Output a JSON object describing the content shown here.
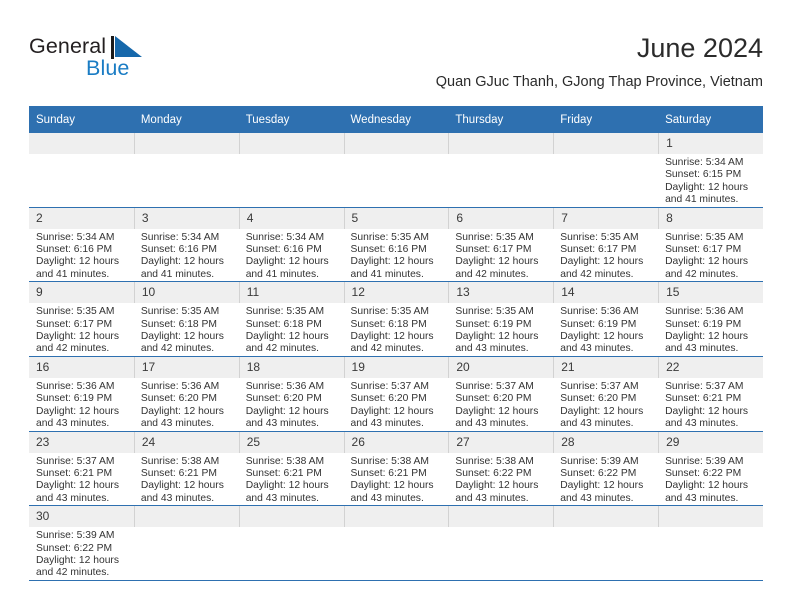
{
  "brand": {
    "name_dark": "General",
    "name_blue": "Blue",
    "flag_icon": "blue-triangle-flag-icon",
    "blue": "#1a7cc4"
  },
  "header": {
    "title": "June 2024",
    "subtitle": "Quan GJuc Thanh, GJong Thap Province, Vietnam"
  },
  "theme": {
    "header_blue": "#2e70b0",
    "daynum_gray": "#efefef",
    "grid_line": "#2e70b0"
  },
  "weekday_headers": [
    "Sunday",
    "Monday",
    "Tuesday",
    "Wednesday",
    "Thursday",
    "Friday",
    "Saturday"
  ],
  "weeks": [
    [
      {
        "empty": true
      },
      {
        "empty": true
      },
      {
        "empty": true
      },
      {
        "empty": true
      },
      {
        "empty": true
      },
      {
        "empty": true
      },
      {
        "day": "1",
        "sunrise": "Sunrise: 5:34 AM",
        "sunset": "Sunset: 6:15 PM",
        "daylight1": "Daylight: 12 hours",
        "daylight2": "and 41 minutes."
      }
    ],
    [
      {
        "day": "2",
        "sunrise": "Sunrise: 5:34 AM",
        "sunset": "Sunset: 6:16 PM",
        "daylight1": "Daylight: 12 hours",
        "daylight2": "and 41 minutes."
      },
      {
        "day": "3",
        "sunrise": "Sunrise: 5:34 AM",
        "sunset": "Sunset: 6:16 PM",
        "daylight1": "Daylight: 12 hours",
        "daylight2": "and 41 minutes."
      },
      {
        "day": "4",
        "sunrise": "Sunrise: 5:34 AM",
        "sunset": "Sunset: 6:16 PM",
        "daylight1": "Daylight: 12 hours",
        "daylight2": "and 41 minutes."
      },
      {
        "day": "5",
        "sunrise": "Sunrise: 5:35 AM",
        "sunset": "Sunset: 6:16 PM",
        "daylight1": "Daylight: 12 hours",
        "daylight2": "and 41 minutes."
      },
      {
        "day": "6",
        "sunrise": "Sunrise: 5:35 AM",
        "sunset": "Sunset: 6:17 PM",
        "daylight1": "Daylight: 12 hours",
        "daylight2": "and 42 minutes."
      },
      {
        "day": "7",
        "sunrise": "Sunrise: 5:35 AM",
        "sunset": "Sunset: 6:17 PM",
        "daylight1": "Daylight: 12 hours",
        "daylight2": "and 42 minutes."
      },
      {
        "day": "8",
        "sunrise": "Sunrise: 5:35 AM",
        "sunset": "Sunset: 6:17 PM",
        "daylight1": "Daylight: 12 hours",
        "daylight2": "and 42 minutes."
      }
    ],
    [
      {
        "day": "9",
        "sunrise": "Sunrise: 5:35 AM",
        "sunset": "Sunset: 6:17 PM",
        "daylight1": "Daylight: 12 hours",
        "daylight2": "and 42 minutes."
      },
      {
        "day": "10",
        "sunrise": "Sunrise: 5:35 AM",
        "sunset": "Sunset: 6:18 PM",
        "daylight1": "Daylight: 12 hours",
        "daylight2": "and 42 minutes."
      },
      {
        "day": "11",
        "sunrise": "Sunrise: 5:35 AM",
        "sunset": "Sunset: 6:18 PM",
        "daylight1": "Daylight: 12 hours",
        "daylight2": "and 42 minutes."
      },
      {
        "day": "12",
        "sunrise": "Sunrise: 5:35 AM",
        "sunset": "Sunset: 6:18 PM",
        "daylight1": "Daylight: 12 hours",
        "daylight2": "and 42 minutes."
      },
      {
        "day": "13",
        "sunrise": "Sunrise: 5:35 AM",
        "sunset": "Sunset: 6:19 PM",
        "daylight1": "Daylight: 12 hours",
        "daylight2": "and 43 minutes."
      },
      {
        "day": "14",
        "sunrise": "Sunrise: 5:36 AM",
        "sunset": "Sunset: 6:19 PM",
        "daylight1": "Daylight: 12 hours",
        "daylight2": "and 43 minutes."
      },
      {
        "day": "15",
        "sunrise": "Sunrise: 5:36 AM",
        "sunset": "Sunset: 6:19 PM",
        "daylight1": "Daylight: 12 hours",
        "daylight2": "and 43 minutes."
      }
    ],
    [
      {
        "day": "16",
        "sunrise": "Sunrise: 5:36 AM",
        "sunset": "Sunset: 6:19 PM",
        "daylight1": "Daylight: 12 hours",
        "daylight2": "and 43 minutes."
      },
      {
        "day": "17",
        "sunrise": "Sunrise: 5:36 AM",
        "sunset": "Sunset: 6:20 PM",
        "daylight1": "Daylight: 12 hours",
        "daylight2": "and 43 minutes."
      },
      {
        "day": "18",
        "sunrise": "Sunrise: 5:36 AM",
        "sunset": "Sunset: 6:20 PM",
        "daylight1": "Daylight: 12 hours",
        "daylight2": "and 43 minutes."
      },
      {
        "day": "19",
        "sunrise": "Sunrise: 5:37 AM",
        "sunset": "Sunset: 6:20 PM",
        "daylight1": "Daylight: 12 hours",
        "daylight2": "and 43 minutes."
      },
      {
        "day": "20",
        "sunrise": "Sunrise: 5:37 AM",
        "sunset": "Sunset: 6:20 PM",
        "daylight1": "Daylight: 12 hours",
        "daylight2": "and 43 minutes."
      },
      {
        "day": "21",
        "sunrise": "Sunrise: 5:37 AM",
        "sunset": "Sunset: 6:20 PM",
        "daylight1": "Daylight: 12 hours",
        "daylight2": "and 43 minutes."
      },
      {
        "day": "22",
        "sunrise": "Sunrise: 5:37 AM",
        "sunset": "Sunset: 6:21 PM",
        "daylight1": "Daylight: 12 hours",
        "daylight2": "and 43 minutes."
      }
    ],
    [
      {
        "day": "23",
        "sunrise": "Sunrise: 5:37 AM",
        "sunset": "Sunset: 6:21 PM",
        "daylight1": "Daylight: 12 hours",
        "daylight2": "and 43 minutes."
      },
      {
        "day": "24",
        "sunrise": "Sunrise: 5:38 AM",
        "sunset": "Sunset: 6:21 PM",
        "daylight1": "Daylight: 12 hours",
        "daylight2": "and 43 minutes."
      },
      {
        "day": "25",
        "sunrise": "Sunrise: 5:38 AM",
        "sunset": "Sunset: 6:21 PM",
        "daylight1": "Daylight: 12 hours",
        "daylight2": "and 43 minutes."
      },
      {
        "day": "26",
        "sunrise": "Sunrise: 5:38 AM",
        "sunset": "Sunset: 6:21 PM",
        "daylight1": "Daylight: 12 hours",
        "daylight2": "and 43 minutes."
      },
      {
        "day": "27",
        "sunrise": "Sunrise: 5:38 AM",
        "sunset": "Sunset: 6:22 PM",
        "daylight1": "Daylight: 12 hours",
        "daylight2": "and 43 minutes."
      },
      {
        "day": "28",
        "sunrise": "Sunrise: 5:39 AM",
        "sunset": "Sunset: 6:22 PM",
        "daylight1": "Daylight: 12 hours",
        "daylight2": "and 43 minutes."
      },
      {
        "day": "29",
        "sunrise": "Sunrise: 5:39 AM",
        "sunset": "Sunset: 6:22 PM",
        "daylight1": "Daylight: 12 hours",
        "daylight2": "and 43 minutes."
      }
    ],
    [
      {
        "day": "30",
        "sunrise": "Sunrise: 5:39 AM",
        "sunset": "Sunset: 6:22 PM",
        "daylight1": "Daylight: 12 hours",
        "daylight2": "and 42 minutes."
      },
      {
        "empty": true
      },
      {
        "empty": true
      },
      {
        "empty": true
      },
      {
        "empty": true
      },
      {
        "empty": true
      },
      {
        "empty": true
      }
    ]
  ]
}
